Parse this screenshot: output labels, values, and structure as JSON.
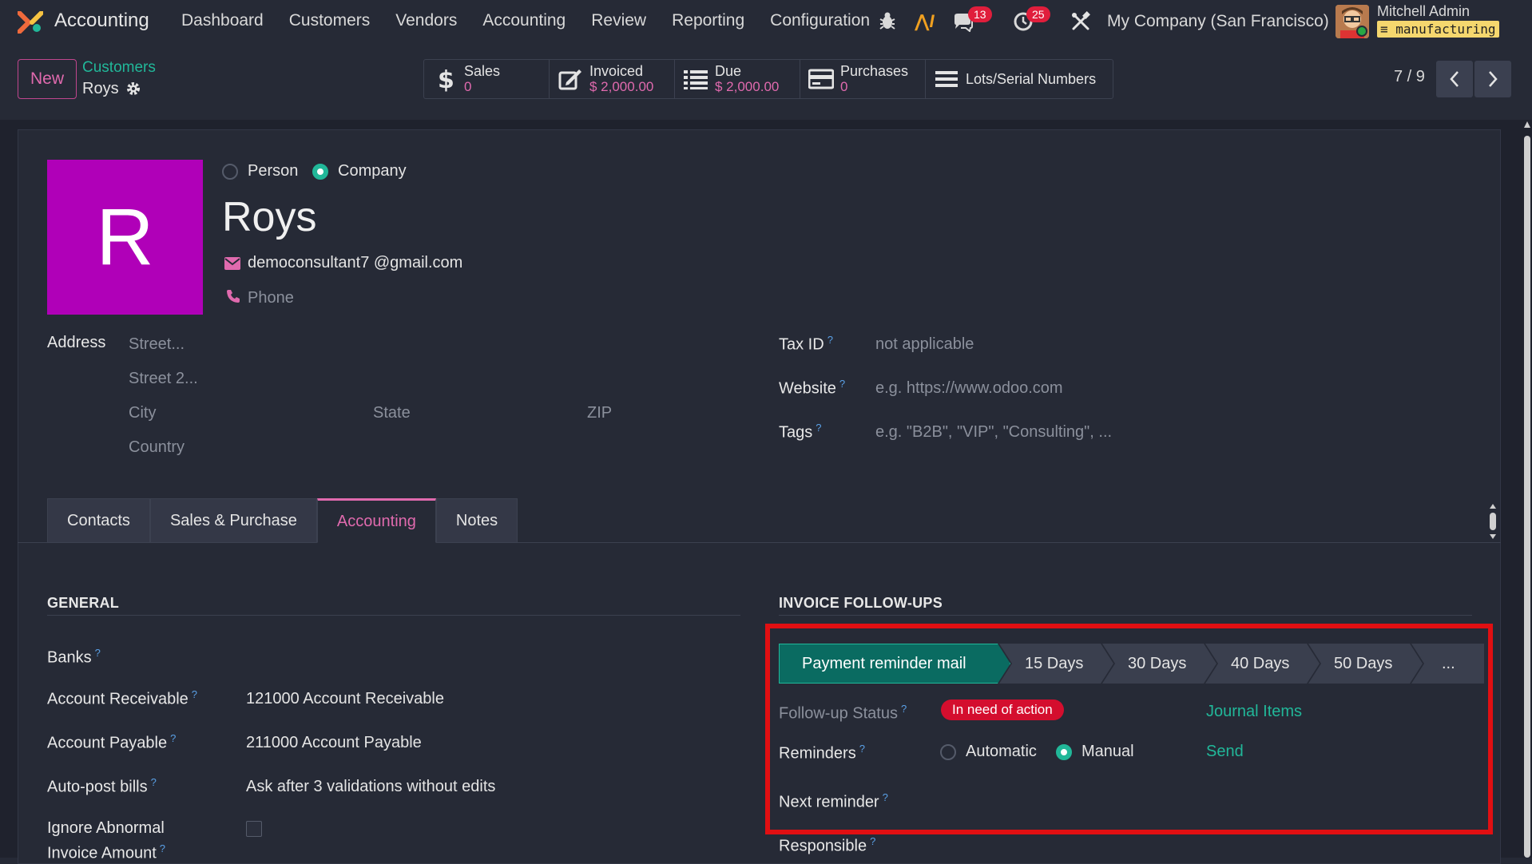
{
  "navbar": {
    "app_name": "Accounting",
    "menu": [
      "Dashboard",
      "Customers",
      "Vendors",
      "Accounting",
      "Review",
      "Reporting",
      "Configuration"
    ],
    "messages_count": "13",
    "activities_count": "25",
    "company": "My Company (San Francisco)",
    "user_name": "Mitchell Admin",
    "database": "manufacturing"
  },
  "control_panel": {
    "new_label": "New",
    "breadcrumb_parent": "Customers",
    "breadcrumb_current": "Roys",
    "smart_buttons": [
      {
        "label": "Sales",
        "value": "0",
        "icon": "dollar-icon"
      },
      {
        "label": "Invoiced",
        "value": "$ 2,000.00",
        "icon": "edit-icon"
      },
      {
        "label": "Due",
        "value": "$ 2,000.00",
        "icon": "list-icon"
      },
      {
        "label": "Purchases",
        "value": "0",
        "icon": "credit-card-icon"
      },
      {
        "label": "Lots/Serial Numbers",
        "value": "",
        "icon": "bars-icon"
      }
    ],
    "pager": "7 / 9"
  },
  "partner": {
    "avatar_letter": "R",
    "type_person": "Person",
    "type_company": "Company",
    "selected_type": "Company",
    "name": "Roys",
    "email": "democonsultant7 @gmail.com",
    "phone_placeholder": "Phone"
  },
  "address": {
    "label": "Address",
    "street_placeholder": "Street...",
    "street2_placeholder": "Street 2...",
    "city_placeholder": "City",
    "state_placeholder": "State",
    "zip_placeholder": "ZIP",
    "country_placeholder": "Country"
  },
  "right_fields": {
    "tax_id_label": "Tax ID",
    "tax_id_value": "not applicable",
    "website_label": "Website",
    "website_placeholder": "e.g. https://www.odoo.com",
    "tags_label": "Tags",
    "tags_placeholder": "e.g. \"B2B\", \"VIP\", \"Consulting\", ..."
  },
  "tabs": [
    "Contacts",
    "Sales & Purchase",
    "Accounting",
    "Notes"
  ],
  "active_tab": "Accounting",
  "general": {
    "title": "GENERAL",
    "banks_label": "Banks",
    "receivable_label": "Account Receivable",
    "receivable_value": "121000 Account Receivable",
    "payable_label": "Account Payable",
    "payable_value": "211000 Account Payable",
    "autopost_label": "Auto-post bills",
    "autopost_value": "Ask after 3 validations without edits",
    "ignore_label_1": "Ignore Abnormal",
    "ignore_label_2": "Invoice Amount"
  },
  "followups": {
    "title": "INVOICE FOLLOW-UPS",
    "stages": [
      "Payment reminder mail",
      "15 Days",
      "30 Days",
      "40 Days",
      "50 Days",
      "..."
    ],
    "status_label": "Follow-up Status",
    "status_value": "In need of action",
    "journal_items_link": "Journal Items",
    "reminders_label": "Reminders",
    "reminder_automatic": "Automatic",
    "reminder_manual": "Manual",
    "reminder_selected": "Manual",
    "send_link": "Send",
    "next_reminder_label": "Next reminder",
    "responsible_label": "Responsible"
  },
  "colors": {
    "accent_teal": "#21b799",
    "accent_pink": "#e06aae",
    "avatar_bg": "#b000b8",
    "status_red": "#d40e2e",
    "highlight_red": "#e10f12"
  }
}
